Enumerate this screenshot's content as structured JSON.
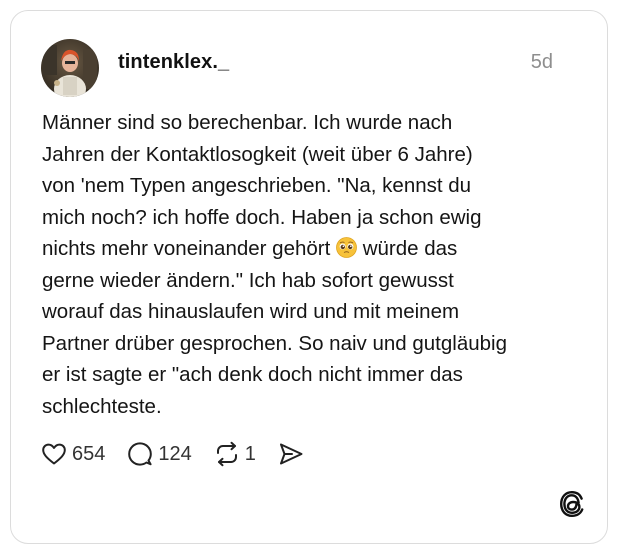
{
  "post": {
    "username": "tintenklex._",
    "timestamp": "5d",
    "text_part1": "Männer sind so berechenbar. Ich wurde nach\nJahren der Kontaktlosogkeit (weit über 6 Jahre)\nvon 'nem Typen angeschrieben. \"Na, kennst du\nmich noch? ich hoffe doch. Haben ja schon ewig\nnichts mehr voneinander gehört ",
    "emoji": "pleading-face-emoji",
    "text_part2": " würde das\ngerne wieder ändern.\" Ich hab sofort gewusst\nworauf das hinauslaufen wird und mit meinem\nPartner drüber gesprochen. So naiv und gutgläubig\ner ist sagte er \"ach denk doch nicht immer das\nschlechteste."
  },
  "actions": {
    "likes": "654",
    "comments": "124",
    "reposts": "1"
  },
  "icons": {
    "like": "heart-icon",
    "comment": "comment-bubble-icon",
    "repost": "repost-icon",
    "share": "send-icon",
    "brand": "threads-logo"
  },
  "colors": {
    "text": "#151515",
    "muted": "#8e8e8e",
    "border": "#dcdcdc"
  }
}
